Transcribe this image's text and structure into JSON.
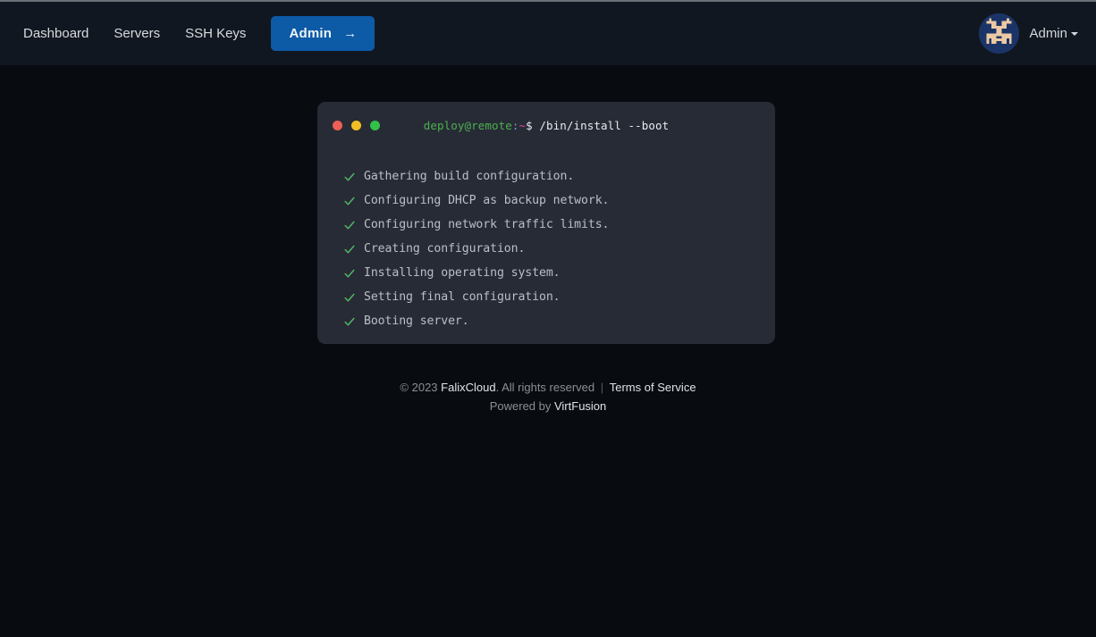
{
  "navbar": {
    "links": [
      {
        "label": "Dashboard"
      },
      {
        "label": "Servers"
      },
      {
        "label": "SSH Keys"
      }
    ],
    "admin_button": {
      "label": "Admin",
      "arrow": "→"
    },
    "user": {
      "name": "Admin",
      "avatar_alt": "user-identicon"
    }
  },
  "terminal": {
    "dots": [
      "red",
      "yellow",
      "green"
    ],
    "prompt": {
      "user_host": "deploy@remote",
      "colon": ":",
      "tilde": "~",
      "dollar": "$",
      "command": "/bin/install --boot"
    },
    "tasks": [
      {
        "status": "done",
        "text": "Gathering build configuration."
      },
      {
        "status": "done",
        "text": "Configuring DHCP as backup network."
      },
      {
        "status": "done",
        "text": "Configuring network traffic limits."
      },
      {
        "status": "done",
        "text": "Creating configuration."
      },
      {
        "status": "done",
        "text": "Installing operating system."
      },
      {
        "status": "done",
        "text": "Setting final configuration."
      },
      {
        "status": "done",
        "text": "Booting server."
      }
    ]
  },
  "footer": {
    "copyright_prefix": "© 2023 ",
    "brand": "FalixCloud",
    "rights": ". All rights reserved ",
    "separator": "|",
    "terms_link": "Terms of Service",
    "powered_prefix": "Powered by ",
    "powered_brand": "VirtFusion"
  },
  "colors": {
    "page_bg": "#080b10",
    "navbar_bg": "#111720",
    "card_bg": "#272b35",
    "accent_blue": "#0d5aa7",
    "check_green": "#4fb860",
    "prompt_green": "#4caf50",
    "prompt_magenta": "#d946a8",
    "dot_red": "#ee5f56",
    "dot_yellow": "#f2c024",
    "dot_green": "#33c14b"
  }
}
